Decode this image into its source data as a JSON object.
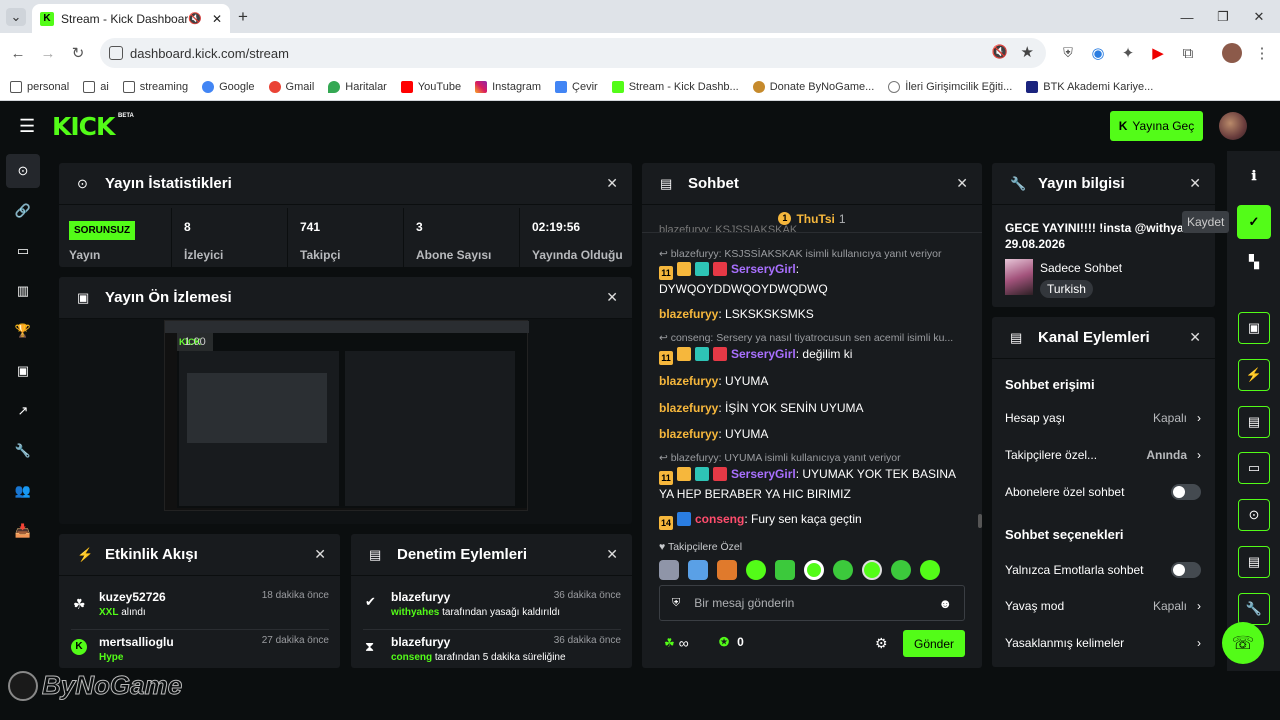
{
  "browser": {
    "tab_title": "Stream - Kick Dashboard",
    "url": "dashboard.kick.com/stream",
    "bookmarks": [
      "personal",
      "ai",
      "streaming",
      "Google",
      "Gmail",
      "Haritalar",
      "YouTube",
      "Instagram",
      "Çevir",
      "Stream - Kick Dashb...",
      "Donate ByNoGame...",
      "İleri Girişimcilik Eğiti...",
      "BTK Akademi Kariye..."
    ]
  },
  "header": {
    "logo": "KICK",
    "beta": "BETA",
    "go_live": "Yayına Geç"
  },
  "stats": {
    "title": "Yayın İstatistikleri",
    "status": "SORUNSUZ",
    "status_label": "Yayın",
    "items": [
      {
        "value": "8",
        "label": "İzleyici"
      },
      {
        "value": "741",
        "label": "Takipçi"
      },
      {
        "value": "3",
        "label": "Abone Sayısı"
      },
      {
        "value": "02:19:56",
        "label": "Yayında Olduğu"
      }
    ]
  },
  "preview": {
    "title": "Yayın Ön İzlemesi",
    "zoom": "1.00"
  },
  "activity": {
    "title": "Etkinlik Akışı",
    "items": [
      {
        "name": "kuzey52726",
        "time": "18 dakika önce",
        "hl": "XXL",
        "rest": "alındı"
      },
      {
        "name": "mertsallioglu",
        "time": "27 dakika önce",
        "hl": "Hype",
        "rest": ""
      }
    ]
  },
  "moderation": {
    "title": "Denetim Eylemleri",
    "items": [
      {
        "name": "blazefuryy",
        "time": "36 dakika önce",
        "hl": "withyahes",
        "rest": "tarafından yasağı kaldırıldı"
      },
      {
        "name": "blazefuryy",
        "time": "36 dakika önce",
        "hl": "conseng",
        "rest": "tarafından 5 dakika süreliğine"
      }
    ]
  },
  "chat": {
    "title": "Sohbet",
    "pinned_user": "ThuTsi",
    "pinned_count": "1",
    "top_cut": "blazefuryy: KSJSSIAKSKAK",
    "messages": [
      {
        "reply": "blazefuryy: KSJSSİAKSKAK isimli kullanıcıya yanıt veriyor",
        "badge": "11",
        "user": "SerseryGirl",
        "text": "DYWQOYDDWQOYDWQDWQ"
      },
      {
        "user": "blazefuryy",
        "text": "LSKSKSKSMKS"
      },
      {
        "reply": "conseng: Sersery ya nasıl tiyatrocusun sen acemil isimli ku...",
        "badge": "11",
        "user": "SerseryGirl",
        "text": "değilim ki"
      },
      {
        "user": "blazefuryy",
        "text": "UYUMA"
      },
      {
        "user": "blazefuryy",
        "text": "İŞİN YOK SENİN UYUMA"
      },
      {
        "user": "blazefuryy",
        "text": "UYUMA"
      },
      {
        "reply": "blazefuryy: UYUMA isimli kullanıcıya yanıt veriyor",
        "badge": "11",
        "user": "SerseryGirl",
        "text": "UYUMAK YOK TEK BASINA YA HEP BERABER YA HIC BIRIMIZ"
      },
      {
        "badge": "14",
        "user": "conseng",
        "text": "Fury sen kaça geçtin"
      }
    ],
    "followers_only": "Takipçilere Özel",
    "input_placeholder": "Bir mesaj gönderin",
    "points": "∞",
    "count": "0",
    "send": "Gönder"
  },
  "stream_info": {
    "title": "Yayın bilgisi",
    "stream_title": "GECE YAYINI!!!! !insta @withyahes 29.08.2026",
    "category": "Sadece Sohbet",
    "language": "Turkish",
    "save_tooltip": "Kaydet"
  },
  "channel_actions": {
    "title": "Kanal Eylemleri",
    "section1": "Sohbet erişimi",
    "rows1": [
      {
        "label": "Hesap yaşı",
        "value": "Kapalı"
      },
      {
        "label": "Takipçilere özel...",
        "value": "Anında"
      },
      {
        "label": "Abonelere özel sohbet",
        "value": ""
      }
    ],
    "section2": "Sohbet seçenekleri",
    "rows2": [
      {
        "label": "Yalnızca Emotlarla sohbet",
        "value": ""
      },
      {
        "label": "Yavaş mod",
        "value": "Kapalı"
      },
      {
        "label": "Yasaklanmış kelimeler",
        "value": ""
      }
    ]
  },
  "watermark": "ByNoGame",
  "colors": {
    "accent": "#53fc18",
    "panel": "#181b1e",
    "bg": "#0b0e0f",
    "sersery": "#a970ff",
    "conseng": "#ff4d6d",
    "blazefuryy": "#f6b73c"
  }
}
